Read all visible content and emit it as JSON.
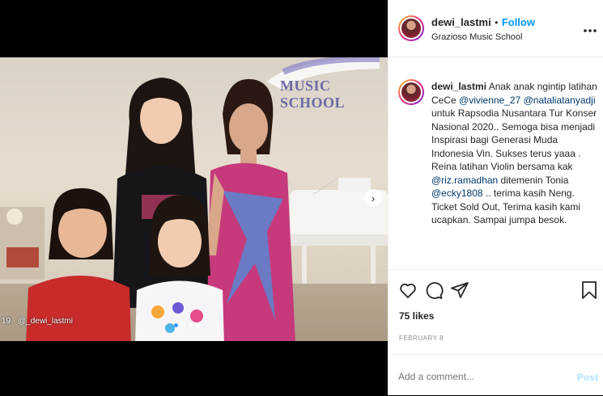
{
  "photo": {
    "sign_text": "MUSIC SCHOOL",
    "watermark": "19 · @_dewi_lastmi",
    "carousel": {
      "count": 4,
      "active_index": 0
    }
  },
  "header": {
    "username": "dewi_lastmi",
    "separator": "•",
    "follow_label": "Follow",
    "location": "Grazioso Music School",
    "more_icon": "more-horizontal-icon"
  },
  "caption": {
    "username": "dewi_lastmi",
    "segments": [
      {
        "text": "Anak anak ngintip latihan CeCe ",
        "type": "text"
      },
      {
        "text": "@vivienne_27",
        "type": "mention"
      },
      {
        "text": " ",
        "type": "text"
      },
      {
        "text": "@nataliatanyadji",
        "type": "mention"
      },
      {
        "text": " untuk Rapsodia Nusantara Tur Konser Nasional 2020.. Semoga bisa menjadi Inspirasi bagi Generasi Muda Indonesia Vin. Sukses terus yaaa . Reina latihan Violin bersama kak ",
        "type": "text"
      },
      {
        "text": "@riz.ramadhan",
        "type": "mention"
      },
      {
        "text": " ditemenin Tonia ",
        "type": "text"
      },
      {
        "text": "@ecky1808",
        "type": "mention"
      },
      {
        "text": " .. terima kasih Neng. Ticket Sold Out, Terima kasih kami ucapkan. Sampai jumpa besok.",
        "type": "text"
      }
    ]
  },
  "actions": {
    "icons": [
      "heart-icon",
      "comment-icon",
      "share-icon",
      "bookmark-icon"
    ],
    "likes": "75 likes",
    "date": "FEBRUARY 8"
  },
  "comment": {
    "placeholder": "Add a comment...",
    "post_label": "Post"
  },
  "colors": {
    "link": "#0095f6",
    "mention": "#00376b",
    "post_disabled": "#b2dffc",
    "text": "#262626",
    "muted": "#8e8e8e"
  }
}
